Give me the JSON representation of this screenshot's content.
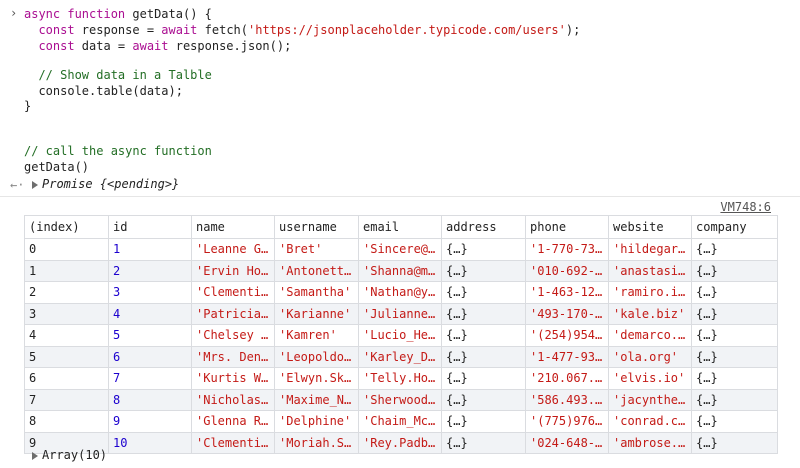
{
  "console": {
    "code_lines": [
      [
        {
          "t": "async ",
          "c": "kw"
        },
        {
          "t": "function ",
          "c": "kw"
        },
        {
          "t": "getData",
          "c": "plain"
        },
        {
          "t": "() {",
          "c": "plain"
        }
      ],
      [
        {
          "t": "  const ",
          "c": "kw"
        },
        {
          "t": "response = ",
          "c": "plain"
        },
        {
          "t": "await ",
          "c": "kw"
        },
        {
          "t": "fetch(",
          "c": "plain"
        },
        {
          "t": "'https://jsonplaceholder.typicode.com/users'",
          "c": "str"
        },
        {
          "t": ");",
          "c": "plain"
        }
      ],
      [
        {
          "t": "  const ",
          "c": "kw"
        },
        {
          "t": "data = ",
          "c": "plain"
        },
        {
          "t": "await ",
          "c": "kw"
        },
        {
          "t": "response.json();",
          "c": "plain"
        }
      ],
      [],
      [
        {
          "t": "  // Show data in a Talble",
          "c": "cm"
        }
      ],
      [
        {
          "t": "  console.table(data);",
          "c": "plain"
        }
      ],
      [
        {
          "t": "}",
          "c": "plain"
        }
      ],
      [],
      [],
      [
        {
          "t": "// call the async function",
          "c": "cm"
        }
      ],
      [
        {
          "t": "getData()",
          "c": "plain"
        }
      ]
    ],
    "return_value": "Promise {<pending>}",
    "source_link": "VM748:6",
    "array_summary": "Array(10)"
  },
  "table": {
    "columns": [
      "(index)",
      "id",
      "name",
      "username",
      "email",
      "address",
      "phone",
      "website",
      "company"
    ],
    "rows": [
      [
        "0",
        "1",
        "'Leanne G…",
        "'Bret'",
        "'Sincere@…",
        "{…}",
        "'1-770-73…",
        "'hildegar…",
        "{…}"
      ],
      [
        "1",
        "2",
        "'Ervin Ho…",
        "'Antonett…",
        "'Shanna@m…",
        "{…}",
        "'010-692-…",
        "'anastasi…",
        "{…}"
      ],
      [
        "2",
        "3",
        "'Clementi…",
        "'Samantha'",
        "'Nathan@y…",
        "{…}",
        "'1-463-12…",
        "'ramiro.i…",
        "{…}"
      ],
      [
        "3",
        "4",
        "'Patricia…",
        "'Karianne'",
        "'Julianne…",
        "{…}",
        "'493-170-…",
        "'kale.biz'",
        "{…}"
      ],
      [
        "4",
        "5",
        "'Chelsey …",
        "'Kamren'",
        "'Lucio_He…",
        "{…}",
        "'(254)954…",
        "'demarco.…",
        "{…}"
      ],
      [
        "5",
        "6",
        "'Mrs. Den…",
        "'Leopoldo…",
        "'Karley_D…",
        "{…}",
        "'1-477-93…",
        "'ola.org'",
        "{…}"
      ],
      [
        "6",
        "7",
        "'Kurtis W…",
        "'Elwyn.Sk…",
        "'Telly.Ho…",
        "{…}",
        "'210.067.…",
        "'elvis.io'",
        "{…}"
      ],
      [
        "7",
        "8",
        "'Nicholas…",
        "'Maxime_N…",
        "'Sherwood…",
        "{…}",
        "'586.493.…",
        "'jacynthe…",
        "{…}"
      ],
      [
        "8",
        "9",
        "'Glenna R…",
        "'Delphine'",
        "'Chaim_Mc…",
        "{…}",
        "'(775)976…",
        "'conrad.c…",
        "{…}"
      ],
      [
        "9",
        "10",
        "'Clementi…",
        "'Moriah.S…",
        "'Rey.Padb…",
        "{…}",
        "'024-648-…",
        "'ambrose.…",
        "{…}"
      ]
    ]
  },
  "icons": {
    "prompt": "chevron-right-icon",
    "return": "return-arrow-icon",
    "expand": "expand-triangle-icon"
  },
  "colors": {
    "keyword": "#aa0d91",
    "string": "#c41a16",
    "comment": "#236e25",
    "number": "#1c00cf",
    "row_stripe": "#f1f3f6",
    "grid": "#dadce0"
  }
}
